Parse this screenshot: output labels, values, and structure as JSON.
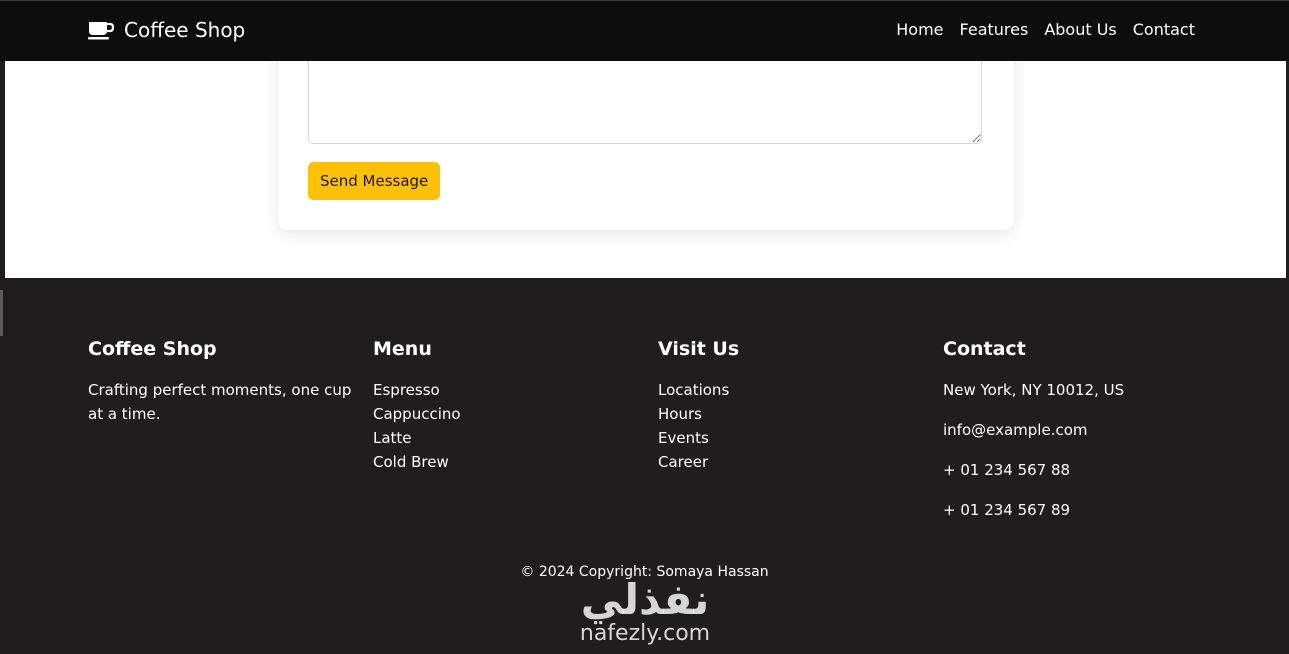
{
  "navbar": {
    "brand_name": "Coffee Shop",
    "brand_icon": "coffee-cup-icon",
    "links": [
      "Home",
      "Features",
      "About Us",
      "Contact"
    ]
  },
  "contact_form": {
    "message_value": "",
    "send_label": "Send Message"
  },
  "footer": {
    "about": {
      "title": "Coffee Shop",
      "tagline": "Crafting perfect moments, one cup at a time."
    },
    "menu": {
      "title": "Menu",
      "items": [
        "Espresso",
        "Cappuccino",
        "Latte",
        "Cold Brew"
      ]
    },
    "visit": {
      "title": "Visit Us",
      "items": [
        "Locations",
        "Hours",
        "Events",
        "Career"
      ]
    },
    "contact": {
      "title": "Contact",
      "address": "New York, NY 10012, US",
      "email": "info@example.com",
      "phone1": "+ 01 234 567 88",
      "phone2": "+ 01 234 567 89"
    },
    "copyright": "© 2024 Copyright: Somaya Hassan"
  },
  "watermark": {
    "arabic": "نفذلي",
    "latin": "nafezly.com"
  },
  "colors": {
    "navbar_bg": "#0d0d0d",
    "footer_bg": "#1f1d1d",
    "accent": "#ffc107",
    "text_light": "#ffffff"
  }
}
